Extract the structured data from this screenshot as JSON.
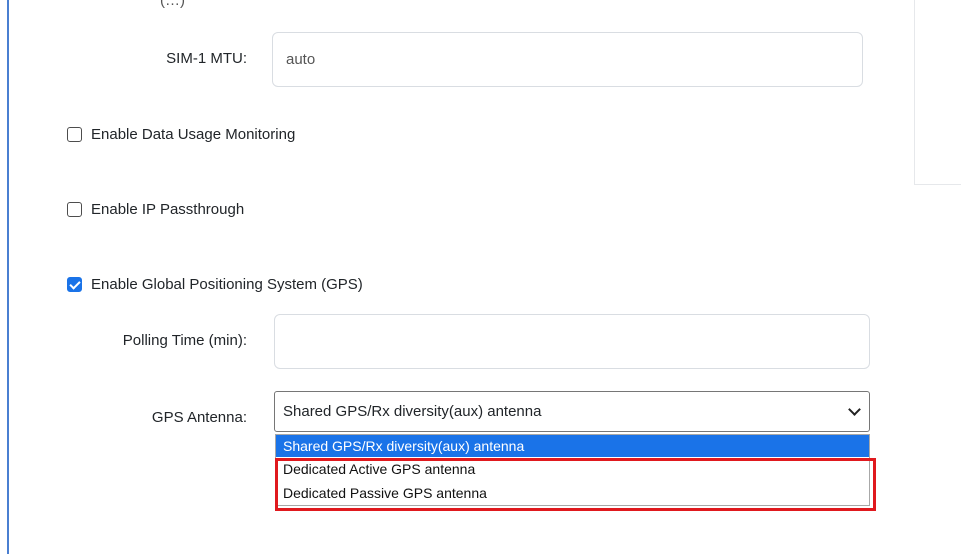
{
  "top_label_clipped": "(…)",
  "sim_mtu": {
    "label": "SIM-1 MTU:",
    "value": "auto"
  },
  "data_usage": {
    "label": "Enable Data Usage Monitoring",
    "checked": false
  },
  "ip_passthrough": {
    "label": "Enable IP Passthrough",
    "checked": false
  },
  "gps": {
    "label": "Enable Global Positioning System (GPS)",
    "checked": true,
    "polling_label": "Polling Time (min):",
    "polling_value": "",
    "antenna_label": "GPS Antenna:",
    "antenna_selected": "Shared GPS/Rx diversity(aux) antenna",
    "antenna_options": [
      "Shared GPS/Rx diversity(aux) antenna",
      "Dedicated Active GPS antenna",
      "Dedicated Passive GPS antenna"
    ]
  },
  "colors": {
    "accent": "#1a73e8",
    "highlight": "#e0191e",
    "frame": "#4a7fd1"
  }
}
